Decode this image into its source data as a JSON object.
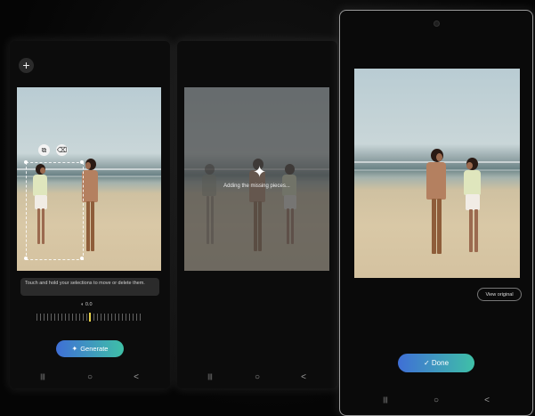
{
  "screen_edit": {
    "add_button": "+",
    "hint": "Touch and hold your selections to move or delete them.",
    "angle_value": "0.0",
    "generate_label": "Generate"
  },
  "screen_generating": {
    "loading_text": "Adding the missing pieces..."
  },
  "screen_result": {
    "view_original_label": "View original",
    "done_label": "Done"
  },
  "nav": {
    "recents": "|||",
    "home": "○",
    "back": "<"
  },
  "icons": {
    "add": "plus-icon",
    "ai": "sparkle-icon",
    "check": "check-icon",
    "chip_left": "copy-icon",
    "chip_right": "eraser-icon"
  },
  "colors": {
    "accent_start": "#3f6fd6",
    "accent_end": "#3fc0a7",
    "ruler_indicator": "#e8d24a"
  }
}
